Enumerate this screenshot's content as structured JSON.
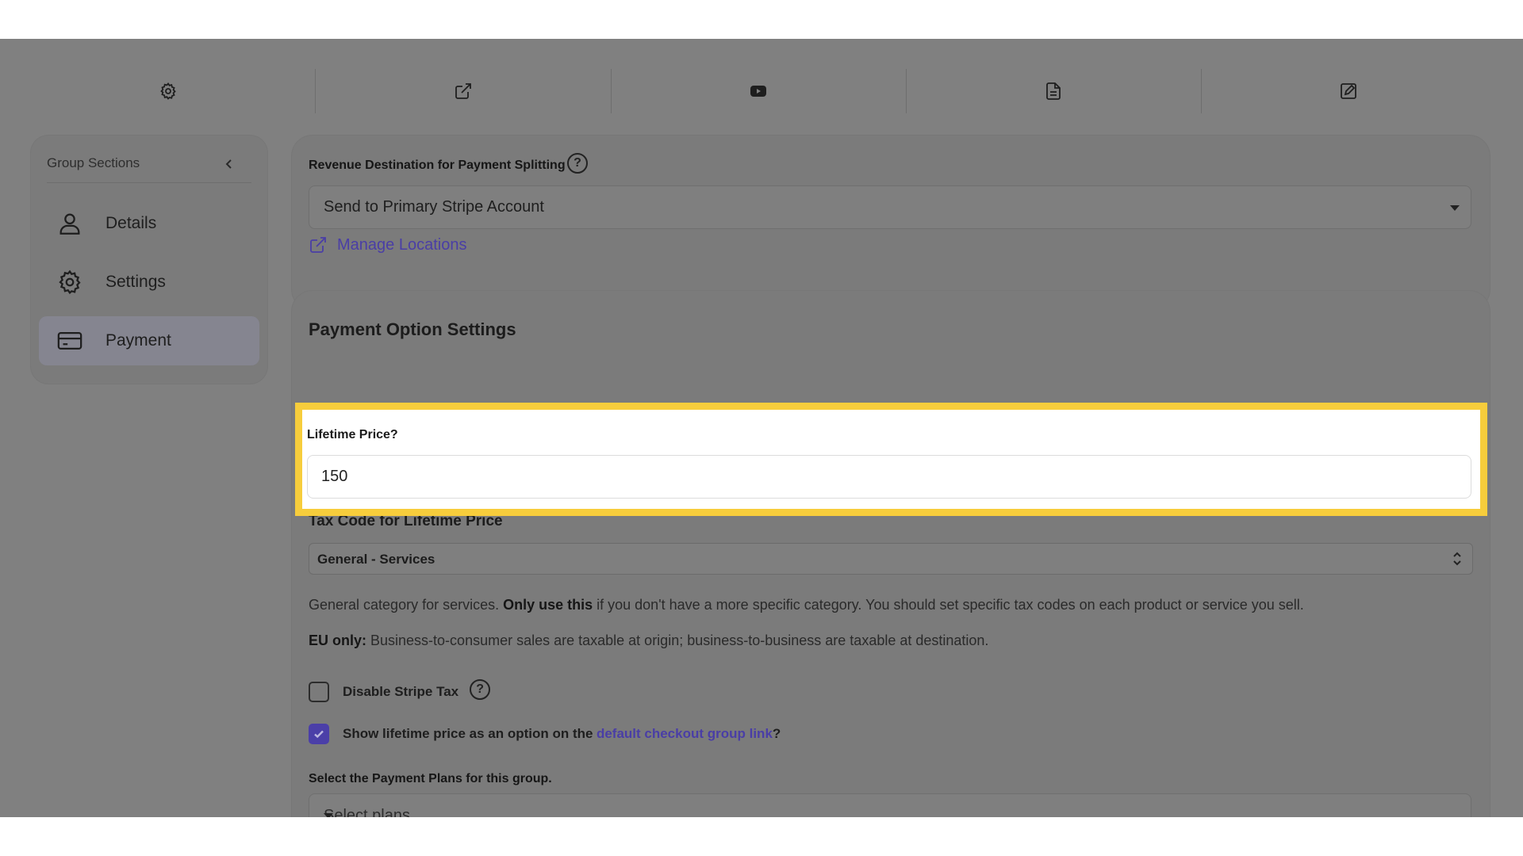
{
  "toolbar": {
    "icons": [
      "settings-gear",
      "external-link",
      "youtube-play",
      "document",
      "edit-square"
    ]
  },
  "sidebar": {
    "title": "Group Sections",
    "items": [
      {
        "label": "Details",
        "icon": "user-icon",
        "active": false
      },
      {
        "label": "Settings",
        "icon": "gear-icon",
        "active": false
      },
      {
        "label": "Payment",
        "icon": "credit-card-icon",
        "active": true
      }
    ]
  },
  "revenue": {
    "label": "Revenue Destination for Payment Splitting",
    "selected": "Send to Primary Stripe Account",
    "link": "Manage Locations"
  },
  "payment_options": {
    "title": "Payment Option Settings",
    "lifetime_label": "Lifetime Price?",
    "lifetime_value": "150",
    "tax_title": "Tax Code for Lifetime Price",
    "tax_selected": "General - Services",
    "desc1_a": "General category for services. ",
    "desc1_bold": "Only use this",
    "desc1_b": " if you don't have a more specific category. You should set specific tax codes on each product or service you sell.",
    "desc2_bold": "EU only:",
    "desc2": " Business-to-consumer sales are taxable at origin; business-to-business are taxable at destination.",
    "disable_tax_label": "Disable Stripe Tax",
    "show_lifetime_a": "Show lifetime price as an option on the ",
    "show_lifetime_link": "default checkout group link",
    "show_lifetime_b": "?",
    "plans_label": "Select the Payment Plans for this group.",
    "plans_placeholder": "Select plans..."
  },
  "colors": {
    "highlight": "#f7cd3c",
    "accent": "#4b3fa8",
    "overlay": "#808080"
  }
}
